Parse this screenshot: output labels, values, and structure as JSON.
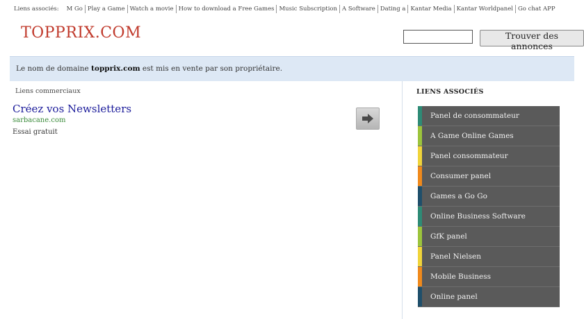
{
  "toplinks": {
    "label": "Liens associés:",
    "items": [
      "M Go",
      "Play a Game",
      "Watch a movie",
      "How to download a Free Games",
      "Music Subscription",
      "A Software",
      "Dating a",
      "Kantar Media",
      "Kantar Worldpanel",
      "Go chat APP"
    ]
  },
  "logo": "TOPPRIX.COM",
  "search": {
    "value": "",
    "button_label": "Trouver des annonces"
  },
  "notice": {
    "before": "Le nom de domaine ",
    "domain": "topprix.com",
    "after": " est mis en vente par son propriétaire."
  },
  "commercial": {
    "title": "Liens commerciaux",
    "ad": {
      "title": "Créez vos Newsletters",
      "url": "sarbacane.com",
      "description": "Essai gratuit"
    }
  },
  "sidebar": {
    "title": "LIENS ASSOCIÉS",
    "items": [
      {
        "label": "Panel de consommateur",
        "color": "#2e8b76"
      },
      {
        "label": "A Game Online Games",
        "color": "#9cc43c"
      },
      {
        "label": "Panel consommateur",
        "color": "#f0d43a"
      },
      {
        "label": "Consumer panel",
        "color": "#f08a1c"
      },
      {
        "label": "Games a Go Go",
        "color": "#1f4f6b"
      },
      {
        "label": "Online Business Software",
        "color": "#2e8b76"
      },
      {
        "label": "GfK panel",
        "color": "#9cc43c"
      },
      {
        "label": "Panel Nielsen",
        "color": "#f0d43a"
      },
      {
        "label": "Mobile Business",
        "color": "#f08a1c"
      },
      {
        "label": "Online panel",
        "color": "#1f4f6b"
      }
    ]
  }
}
